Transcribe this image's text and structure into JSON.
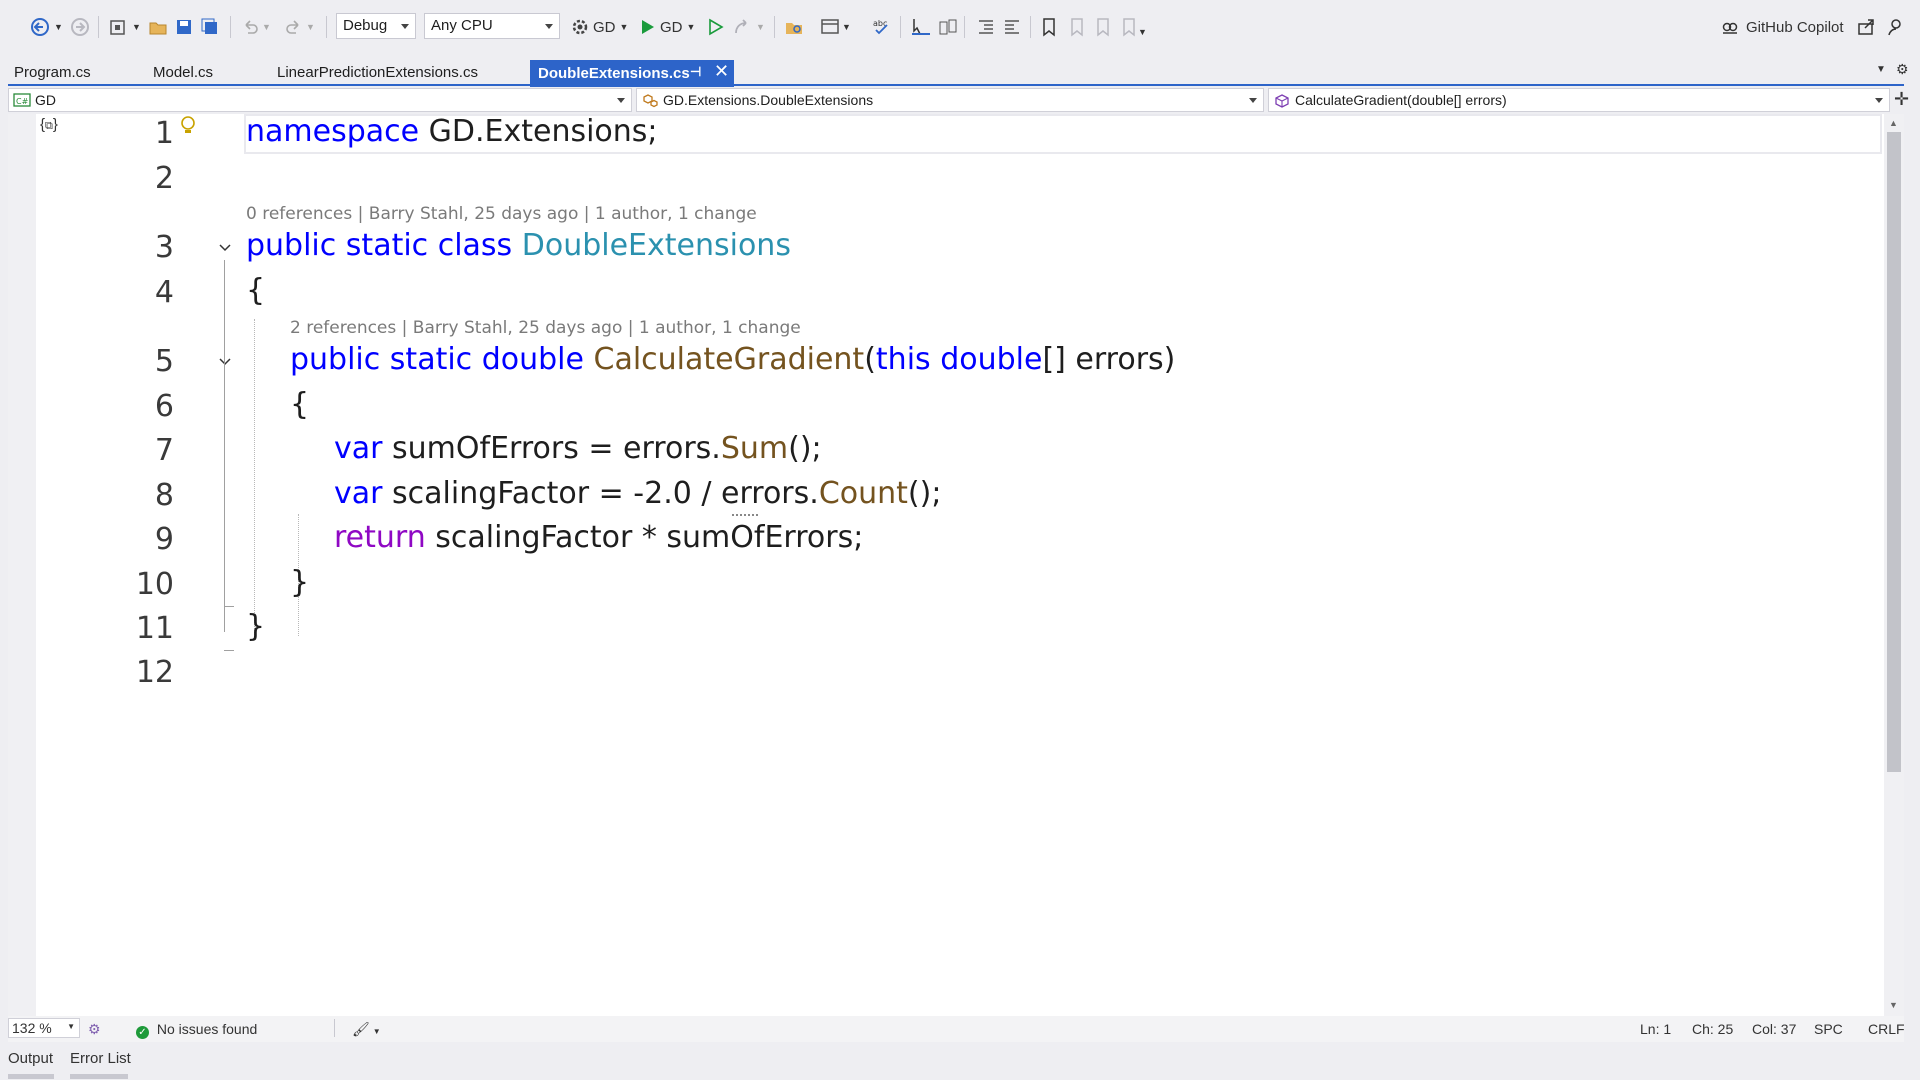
{
  "toolbar": {
    "config": "Debug",
    "platform": "Any CPU",
    "startup_project": "GD",
    "run_target": "GD",
    "copilot": "GitHub Copilot"
  },
  "tabs": [
    {
      "label": "Program.cs"
    },
    {
      "label": "Model.cs"
    },
    {
      "label": "LinearPredictionExtensions.cs"
    },
    {
      "label": "DoubleExtensions.cs",
      "active": true
    }
  ],
  "navbar": {
    "project": "GD",
    "type": "GD.Extensions.DoubleExtensions",
    "member": "CalculateGradient(double[] errors)"
  },
  "editor": {
    "line_numbers": [
      "1",
      "2",
      "3",
      "4",
      "5",
      "6",
      "7",
      "8",
      "9",
      "10",
      "11",
      "12"
    ],
    "codelens_class": "0 references | Barry Stahl, 25 days ago | 1 author, 1 change",
    "codelens_method": "2 references | Barry Stahl, 25 days ago | 1 author, 1 change",
    "tokens": {
      "l1_kw": "namespace",
      "l1_rest": " GD.Extensions;",
      "l3_kw": "public static class",
      "l3_type": "DoubleExtensions",
      "l4": "{",
      "l5_kw1": "public static double",
      "l5_method": "CalculateGradient",
      "l5_p1": "(",
      "l5_kw2": "this double",
      "l5_p2": "[] errors)",
      "l6": "{",
      "l7_kw": "var",
      "l7_a": " sumOfErrors = errors.",
      "l7_m": "Sum",
      "l7_b": "();",
      "l8_kw": "var",
      "l8_a": " scalingFactor = -2.0 / errors.",
      "l8_m": "Count",
      "l8_b": "();",
      "l9_kw": "return",
      "l9_a": " scalingFactor * sumOfErrors;",
      "l10": "}",
      "l11": "}"
    }
  },
  "status": {
    "zoom": "132 %",
    "issues": "No issues found",
    "ln": "Ln: 1",
    "ch": "Ch: 25",
    "col": "Col: 37",
    "spc": "SPC",
    "eol": "CRLF"
  },
  "bottom_tabs": [
    "Output",
    "Error List"
  ]
}
